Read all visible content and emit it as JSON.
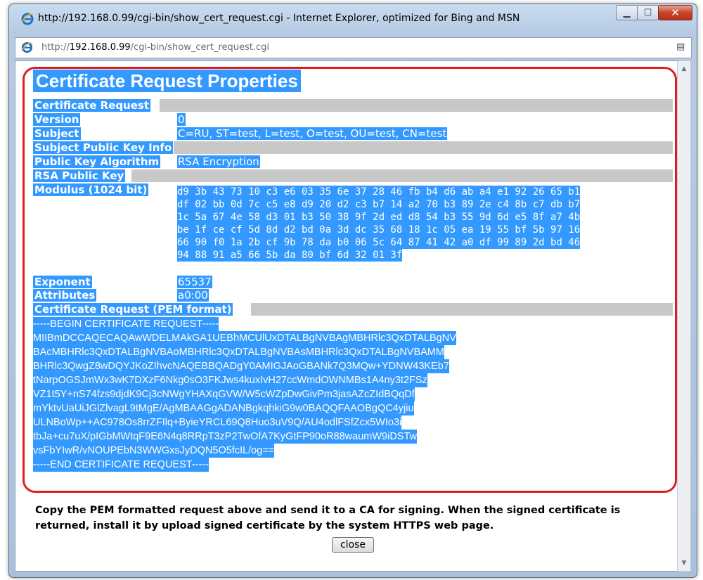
{
  "window": {
    "title": "http://192.168.0.99/cgi-bin/show_cert_request.cgi - Internet Explorer, optimized for Bing and MSN",
    "buttons": [
      "minimize",
      "maximize",
      "close"
    ]
  },
  "address_bar": {
    "prefix": "http://",
    "host": "192.168.0.99",
    "path": "/cgi-bin/show_cert_request.cgi"
  },
  "page": {
    "title": "Certificate Request Properties",
    "rows": {
      "cert_request": {
        "label": "Certificate Request"
      },
      "version": {
        "label": "Version",
        "value": "0"
      },
      "subject": {
        "label": "Subject",
        "value": "C=RU, ST=test, L=test, O=test, OU=test, CN=test"
      },
      "spki": {
        "label": "Subject Public Key Info"
      },
      "pka": {
        "label": "Public Key Algorithm",
        "value": "RSA Encryption"
      },
      "rsa_key": {
        "label": "RSA Public Key"
      },
      "modulus": {
        "label": "Modulus (1024 bit)"
      },
      "exponent": {
        "label": "Exponent",
        "value": "65537"
      },
      "attributes": {
        "label": "Attributes",
        "value": "a0:00"
      },
      "pem": {
        "label": "Certificate Request (PEM format)"
      }
    },
    "modulus_lines": [
      "d9 3b 43 73 10 c3 e6 03 35 6e 37 28 46 fb b4 d6 ab a4 e1 92 26 65 b1",
      "df 02 bb 0d 7c c5 e8 d9 20 d2 c3 b7 14 a2 70 b3 89 2e c4 8b c7 db b7",
      "1c 5a 67 4e 58 d3 01 b3 50 38 9f 2d ed d8 54 b3 55 9d 6d e5 8f a7 4b",
      "be 1f ce cf 5d 8d d2 bd 0a 3d dc 35 68 18 1c 05 ea 19 55 bf 5b 97 16",
      "66 90 f0 1a 2b cf 9b 78 da b0 06 5c 64 87 41 42 a0 df 99 89 2d bd 46",
      "94 88 91 a5 66 5b da 80 bf 6d 32 01 3f"
    ],
    "pem_lines": [
      "-----BEGIN CERTIFICATE REQUEST-----",
      "MIIBmDCCAQECAQAwWDELMAkGA1UEBhMCUlUxDTALBgNVBAgMBHRlc3QxDTALBgNV",
      "BAcMBHRlc3QxDTALBgNVBAoMBHRlc3QxDTALBgNVBAsMBHRlc3QxDTALBgNVBAMM",
      "BHRlc3QwgZ8wDQYJKoZIhvcNAQEBBQADgY0AMIGJAoGBANk7Q3MQw+YDNW43KEb7",
      "tNarpOGSJmWx3wK7DXzF6Nkg0sO3FKJws4kuxIvH27ccWmdOWNMBs1A4ny3t2FSz",
      "VZ1t5Y+nS74fzs9djdK9Cj3cNWgYHAXqGVW/W5cWZpDwGivPm3jasAZcZIdBQqDf",
      "mYktvUaUiJGlZlvagL9tMgE/AgMBAAGgADANBgkqhkiG9w0BAQQFAAOBgQC4yjiu",
      "ULNBoWp++AC978Os8rrZFIlq+ByieYRCL69Q8Huo3uV9Q/AU4odlFSfZcx5WIo3i",
      "tbJa+cu7uX/pIGbMWtqF9E6N4q8RRpT3zP2TwOfA7KyGtFP90oR88waumW9iDSTw",
      "vsFbYIwR/vNOUPEbN3WWGxsJyDQN5O5fcIL/og==",
      "-----END CERTIFICATE REQUEST-----"
    ],
    "instructions": "Copy the PEM formatted request above and send it to a CA for signing. When the signed certificate is returned, install it by upload signed certificate by the system HTTPS web page.",
    "close_label": "close"
  },
  "colors": {
    "selection": "#3399ff",
    "highlight_ring": "#e11b24",
    "row_band": "#c8c8c8"
  }
}
